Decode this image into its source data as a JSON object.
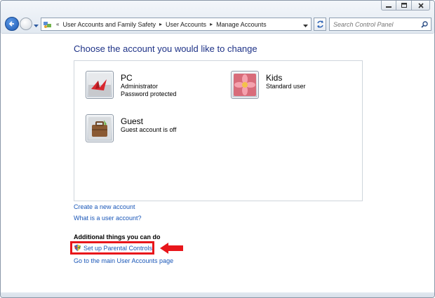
{
  "window": {
    "caption_icons": [
      "minimize-icon",
      "maximize-icon",
      "close-icon"
    ]
  },
  "address_bar": {
    "overflow_glyph": "«",
    "breadcrumbs": [
      "User Accounts and Family Safety",
      "User Accounts",
      "Manage Accounts"
    ]
  },
  "search": {
    "placeholder": "Search Control Panel"
  },
  "main": {
    "heading": "Choose the account you would like to change",
    "accounts": [
      {
        "name": "PC",
        "lines": [
          "Administrator",
          "Password protected"
        ],
        "picture": "origami-crane"
      },
      {
        "name": "Kids",
        "lines": [
          "Standard user"
        ],
        "picture": "pink-flower"
      },
      {
        "name": "Guest",
        "lines": [
          "Guest account is off"
        ],
        "picture": "briefcase"
      }
    ],
    "links": {
      "create_account": "Create a new account",
      "what_is_account": "What is a user account?"
    },
    "additional": {
      "title": "Additional things you can do",
      "parental_controls": "Set up Parental Controls",
      "main_page": "Go to the main User Accounts page"
    }
  },
  "colors": {
    "heading": "#1e3287",
    "link": "#1a57b8",
    "highlight": "#e8161b"
  }
}
